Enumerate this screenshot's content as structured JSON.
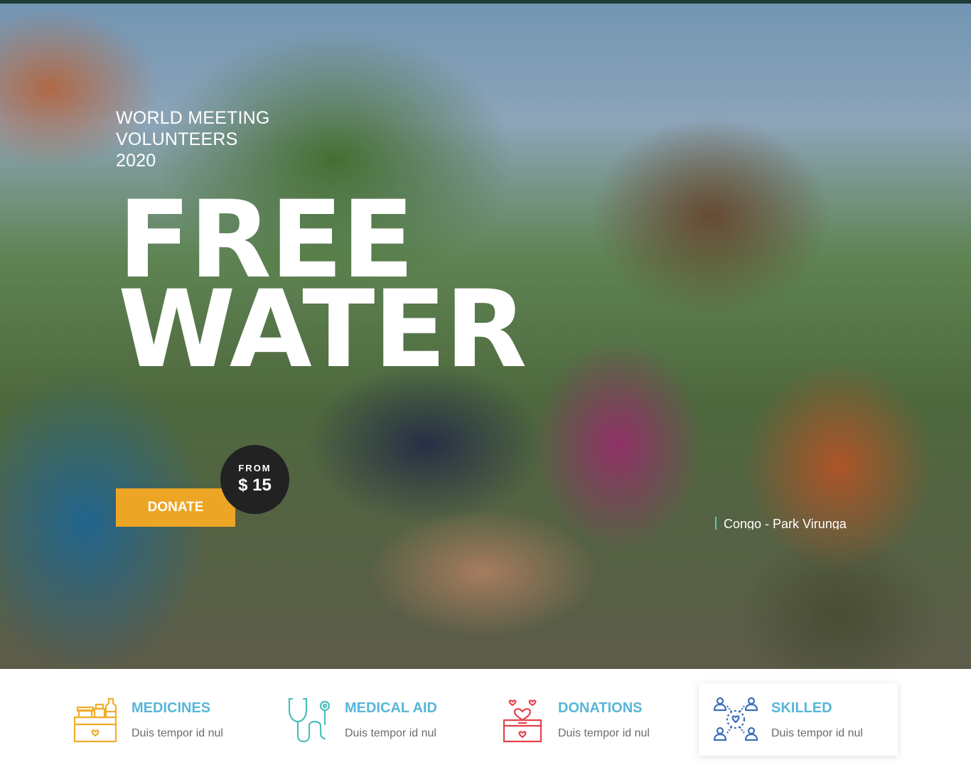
{
  "hero": {
    "eyebrow": [
      "WORLD MEETING",
      "VOLUNTEERS",
      "2020"
    ],
    "headline": [
      "FREE",
      "WATER"
    ],
    "price_label": "FROM",
    "price_value": "$ 15",
    "donate_label": "DONATE",
    "location": "Congo - Park Virunga"
  },
  "features": [
    {
      "title": "MEDICINES",
      "description": "Duis tempor id nul",
      "icon": "medicines-icon",
      "color": "#f0ad2a"
    },
    {
      "title": "MEDICAL AID",
      "description": "Duis tempor id nul",
      "icon": "stethoscope-icon",
      "color": "#4bbfba"
    },
    {
      "title": "DONATIONS",
      "description": "Duis tempor id nul",
      "icon": "donation-box-icon",
      "color": "#e5424b"
    },
    {
      "title": "SKILLED",
      "description": "Duis tempor id nul",
      "icon": "volunteers-network-icon",
      "color": "#3b6fb6"
    }
  ],
  "colors": {
    "topbar": "#1c3a36",
    "accent": "#eca524",
    "feature_title": "#58b6d8",
    "location_marker": "#5ec7c0"
  }
}
